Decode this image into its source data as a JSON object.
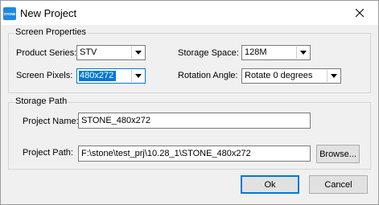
{
  "window": {
    "title": "New Project",
    "icon_text": "STONE",
    "icon": "app-logo-icon",
    "close_icon": "close-icon"
  },
  "screen_properties": {
    "group_label": "Screen Properties",
    "product_series": {
      "label": "Product Series:",
      "value": "STV"
    },
    "storage_space": {
      "label": "Storage Space:",
      "value": "128M"
    },
    "screen_pixels": {
      "label": "Screen Pixels:",
      "value": "480x272"
    },
    "rotation_angle": {
      "label": "Rotation Angle:",
      "value": "Rotate 0 degrees"
    }
  },
  "storage_path": {
    "group_label": "Storage Path",
    "project_name": {
      "label": "Project Name:",
      "value": "STONE_480x272"
    },
    "project_path": {
      "label": "Project Path:",
      "value": "F:\\stone\\test_prj\\10.28_1\\STONE_480x272"
    },
    "browse_label": "Browse..."
  },
  "footer": {
    "ok_label": "Ok",
    "cancel_label": "Cancel"
  },
  "colors": {
    "selection": "#0078d7",
    "icon_bg": "#1e88e5"
  }
}
